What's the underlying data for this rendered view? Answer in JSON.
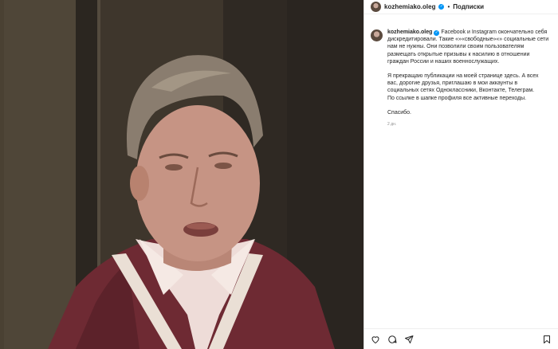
{
  "account": {
    "username": "kozhemiako.oleg",
    "follow_label": "Подписки",
    "separator": "•"
  },
  "post": {
    "caption_p1": "Facebook и Instagram окончательно себя дискредитировали. Такие «»«свободные»«» социальные сети нам не нужны. Они позволили своим пользователям размещать открытые призывы к насилию в отношении граждан России и наших военнослужащих.",
    "caption_p2": "Я прекращаю публикации на моей странице здесь. А всех вас, дорогие друзья, приглашаю в мои аккаунты в социальных сетях Одноклассники, Вконтакте, Телеграм.",
    "caption_p3": "По ссылке в шапке профиля все активные переходы.",
    "caption_p4": "Спасибо.",
    "timestamp": "2 дн."
  },
  "icons": {
    "verified": "verified-badge-icon",
    "like": "heart-icon",
    "comment": "comment-icon",
    "share": "share-icon",
    "save": "bookmark-icon"
  },
  "colors": {
    "accent": "#0095f6",
    "sweater": "#6e2a33",
    "shirt": "#eedcd8",
    "hair": "#8a7d6f",
    "skin": "#c69484"
  }
}
